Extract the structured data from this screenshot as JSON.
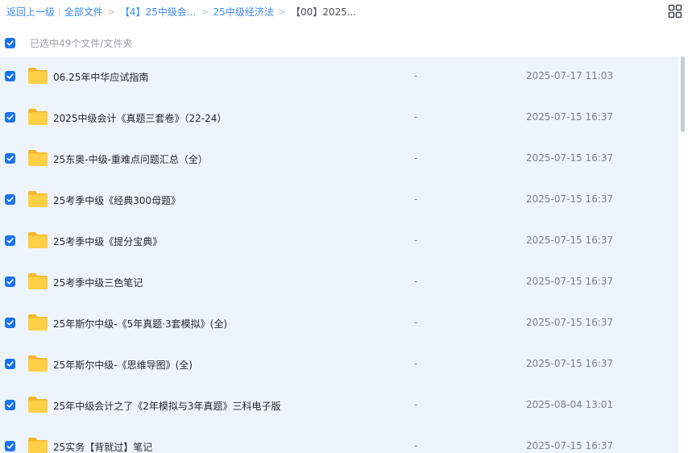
{
  "breadcrumb": {
    "back": "返回上一级",
    "all_files": "全部文件",
    "level1": "【4】25中级会...",
    "level2": "25中级经济法",
    "current": "【00】2025..."
  },
  "toolbar": {
    "view_icon": "grid-view-icon"
  },
  "selection": {
    "text": "已选中49个文件/文件夹",
    "checked": true
  },
  "files": [
    {
      "name": "06.25年中华应试指南",
      "size": "-",
      "date": "2025-07-17 11:03"
    },
    {
      "name": "2025中级会计《真题三套卷》（22-24）",
      "size": "-",
      "date": "2025-07-15 16:37"
    },
    {
      "name": "25东奥-中级-重难点问题汇总（全）",
      "size": "-",
      "date": "2025-07-15 16:37"
    },
    {
      "name": "25考季中级《经典300母题》",
      "size": "-",
      "date": "2025-07-15 16:37"
    },
    {
      "name": "25考季中级《提分宝典》",
      "size": "-",
      "date": "2025-07-15 16:37"
    },
    {
      "name": "25考季中级三色笔记",
      "size": "-",
      "date": "2025-07-15 16:37"
    },
    {
      "name": "25年斯尔中级-《5年真题·3套模拟》(全)",
      "size": "-",
      "date": "2025-07-15 16:37"
    },
    {
      "name": "25年斯尔中级-《思维导图》(全)",
      "size": "-",
      "date": "2025-07-15 16:37"
    },
    {
      "name": "25年中级会计之了《2年模拟与3年真题》三科电子版",
      "size": "-",
      "date": "2025-08-04 13:01"
    },
    {
      "name": "25实务【背就过】笔记",
      "size": "-",
      "date": "2025-07-15 16:37"
    }
  ],
  "colors": {
    "accent": "#1a73f0",
    "link": "#3b8cf5",
    "folder": "#ffc837",
    "selected_bg": "#eef4fd"
  }
}
